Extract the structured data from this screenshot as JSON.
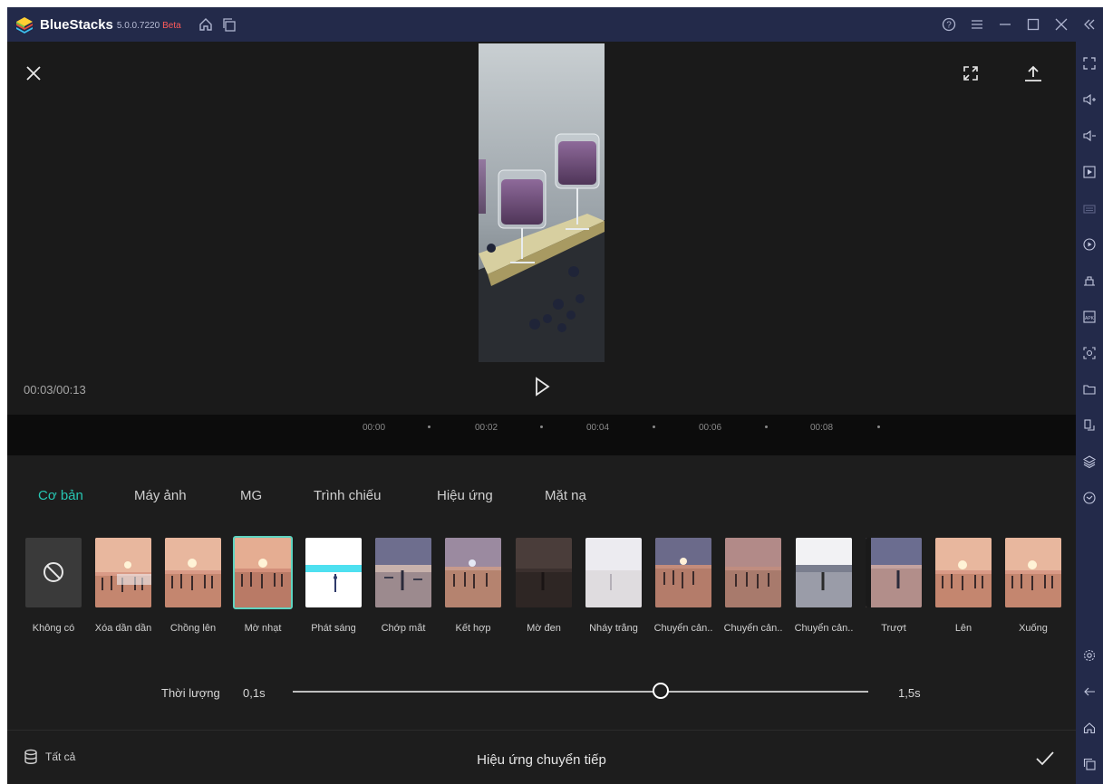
{
  "titlebar": {
    "app_name": "BlueStacks",
    "version": "5.0.0.7220",
    "beta": "Beta"
  },
  "player": {
    "time": "00:03/00:13"
  },
  "timeline": {
    "ticks": [
      "00:00",
      "00:02",
      "00:04",
      "00:06",
      "00:08"
    ]
  },
  "tabs": [
    "Cơ bản",
    "Máy ảnh",
    "MG",
    "Trình chiếu",
    "Hiệu ứng",
    "Mặt nạ"
  ],
  "active_tab": "Cơ bản",
  "transitions": [
    "Không có",
    "Xóa dần dần",
    "Chồng lên",
    "Mờ nhạt",
    "Phát sáng",
    "Chớp mắt",
    "Kết hợp",
    "Mờ đen",
    "Nháy trắng",
    "Chuyển cản..",
    "Chuyển cản..",
    "Chuyển cản..",
    "Trượt",
    "Lên",
    "Xuống"
  ],
  "selected_transition": "Mờ nhạt",
  "duration": {
    "label": "Thời lượng",
    "min": "0,1s",
    "max": "1,5s",
    "fraction": 0.64
  },
  "footer": {
    "all_label": "Tất cả",
    "title": "Hiệu ứng chuyển tiếp"
  },
  "colors": {
    "accent": "#27c6b3",
    "titlebar": "#232a4a",
    "panel": "#1d1d1d"
  }
}
